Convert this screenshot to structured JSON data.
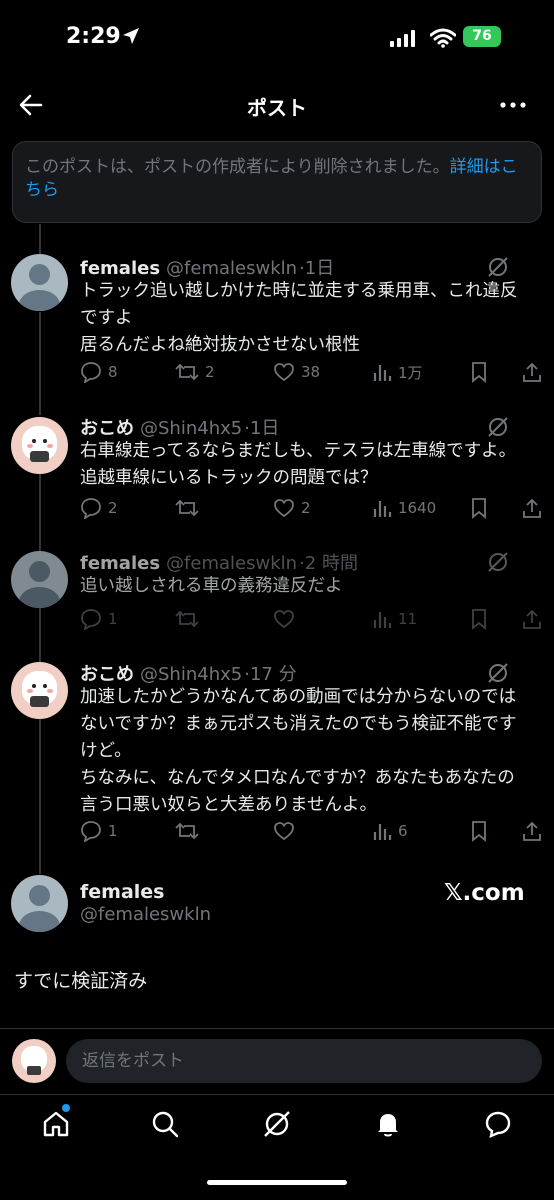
{
  "status": {
    "time": "2:29",
    "battery": "76"
  },
  "nav": {
    "title": "ポスト"
  },
  "notice": {
    "text": "このポストは、ポストの作成者により削除されました。",
    "link": "詳細はこちら"
  },
  "posts": [
    {
      "name": "females",
      "handle": "@femaleswkln",
      "time": "1日",
      "lines": [
        "トラック追い越しかけた時に並走する乗用車、これ違反",
        "ですよ",
        "居るんだよね絶対抜かさせない根性"
      ],
      "replies": "8",
      "reposts": "2",
      "likes": "38",
      "views": "1万"
    },
    {
      "name": "おこめ",
      "handle": "@Shin4hx5",
      "time": "1日",
      "lines": [
        "右車線走ってるならまだしも、テスラは左車線ですよ。",
        "追越車線にいるトラックの問題では？"
      ],
      "replies": "2",
      "reposts": "",
      "likes": "2",
      "views": "1640"
    },
    {
      "name": "females",
      "handle": "@femaleswkln",
      "time": "2 時間",
      "lines": [
        "追い越しされる車の義務違反だよ"
      ],
      "replies": "1",
      "reposts": "",
      "likes": "",
      "views": "11"
    },
    {
      "name": "おこめ",
      "handle": "@Shin4hx5",
      "time": "17 分",
      "lines": [
        "加速したかどうかなんてあの動画では分からないのでは",
        "ないですか？まぁ元ポスも消えたのでもう検証不能です",
        "けど。",
        "ちなみに、なんでタメ口なんですか？あなたもあなたの",
        "言う口悪い奴らと大差ありませんよ。"
      ],
      "replies": "1",
      "reposts": "",
      "likes": "",
      "views": "6"
    }
  ],
  "main": {
    "name": "females",
    "handle": "@femaleswkln",
    "text": "すでに検証済み",
    "watermark": "𝕏.com"
  },
  "reply": {
    "placeholder": "返信をポスト"
  },
  "tabs": [
    "home-icon",
    "search-icon",
    "grok-icon",
    "notifications-icon",
    "messages-icon"
  ]
}
